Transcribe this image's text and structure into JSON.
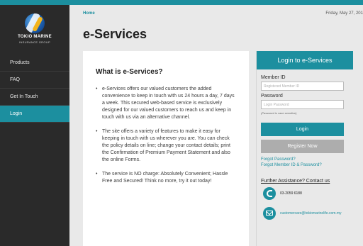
{
  "brand": {
    "logo_line1": "TOKIO MARINE",
    "logo_line2": "INSURANCE GROUP"
  },
  "sidebar": {
    "items": [
      {
        "label": "Products"
      },
      {
        "label": "FAQ"
      },
      {
        "label": "Get In Touch"
      },
      {
        "label": "Login"
      }
    ],
    "active_item": "Login"
  },
  "header": {
    "breadcrumb": "Home",
    "date": "Friday, May 27, 201",
    "title": "e-Services"
  },
  "info": {
    "title": "What is e-Services?",
    "bullets": [
      "e-Services offers our valued customers the added convenience to keep in touch with us 24 hours a day, 7 days a week. This secured web-based service is exclusively designed for our valued customers to reach us and keep in touch with us via an alternative channel.",
      "The site offers a variety of features to make it easy for keeping in touch with us wherever you are. You can check the policy details on line; change your contact details; print the Confirmation of Premium Payment Statement and also the online Forms.",
      "The service is NO charge: Absolutely Convenient; Hassle Free and Secured! Think no more, try it out today!"
    ]
  },
  "login": {
    "header": "Login to e-Services",
    "member_id_label": "Member ID",
    "member_id_placeholder": "Registered Member ID",
    "password_label": "Password",
    "password_placeholder": "Login Password",
    "password_hint": "(Password is case sensitive)",
    "login_button": "Login",
    "register_button": "Register Now",
    "forgot_password": "Forgot Password?",
    "forgot_member_id": "Forgot Member ID & Password?",
    "assistance": "Further Assistance? Contact us",
    "phone": "03-2059 6188",
    "email": "customercare@tokiomarinelife.com.my"
  },
  "colors": {
    "accent": "#1c8f9f",
    "sidebar_bg": "#2a2a2a",
    "page_bg": "#e9e9e9"
  },
  "icons": [
    "logo-icon",
    "phone-icon",
    "mail-icon"
  ]
}
